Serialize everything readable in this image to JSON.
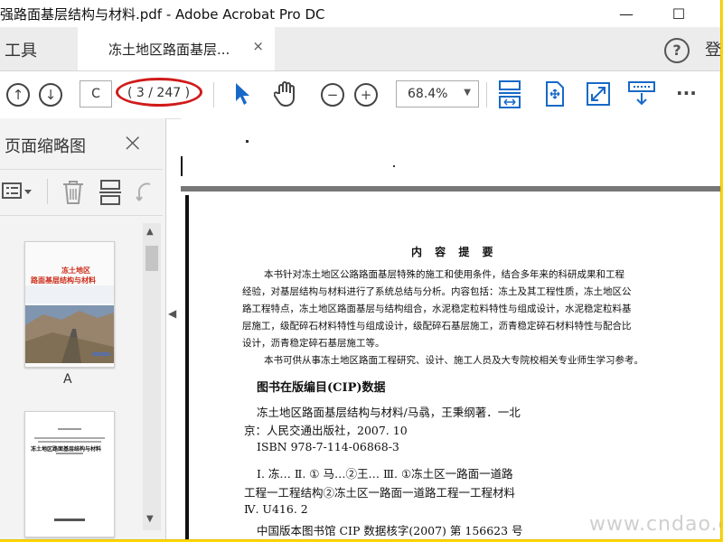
{
  "window": {
    "title": "强路面基层结构与材料.pdf - Adobe Acrobat Pro DC",
    "minimize": "—",
    "maximize": "☐"
  },
  "tabs": {
    "tools": "工具",
    "document": "冻土地区路面基层...",
    "close": "×",
    "help": "?",
    "signin": "登"
  },
  "toolbar": {
    "page_input": "C",
    "page_count": "( 3 / 247 )",
    "zoom": "68.4%",
    "more": "···"
  },
  "panel": {
    "title": "页面缩略图",
    "close": "×",
    "thumb_label_a": "A"
  },
  "thumb1": {
    "title_line1": "冻土地区",
    "title_line2": "路面基层结构与材料"
  },
  "thumb2": {
    "title": "冻土地区路面基层结构与材料"
  },
  "document": {
    "heading": "内 容 提 要",
    "intro_lines": [
      "本书针对冻土地区公路路面基层特殊的施工和使用条件，结合多年来的科研成果和工程",
      "经验，对基层结构与材料进行了系统总结与分析。内容包括：冻土及其工程性质，冻土地区公",
      "路工程特点，冻土地区路面基层与结构组合，水泥稳定粒料特性与组成设计，水泥稳定粒料基",
      "层施工，级配碎石材料特性与组成设计，级配碎石基层施工，沥青稳定碎石材料特性与配合比",
      "设计，沥青稳定碎石基层施工等。",
      "本书可供从事冻土地区路面工程研究、设计、施工人员及大专院校相关专业师生学习参考。"
    ],
    "cip_title": "图书在版编目(CIP)数据",
    "ref_lines": [
      "冻土地区路面基层结构与材料/马骉，王秉纲著．一北",
      "京：人民交通出版社，2007. 10",
      "ISBN  978-7-114-06868-3",
      "Ⅰ. 冻…  Ⅱ. ①  马…②王…  Ⅲ. ①冻土区一路面一道路",
      "工程一工程结构②冻土区一路面一道路工程一工程材料",
      "Ⅳ. U416. 2",
      "中国版本图书馆 CIP 数据核字(2007)   第 156623 号"
    ]
  },
  "watermark": "www.cndao.com",
  "colors": {
    "accent_blue": "#1769c7",
    "annotation_red": "#d01a1a",
    "frame_yellow": "#ffd700"
  },
  "icons": [
    "up-circle-icon",
    "down-circle-icon",
    "select-arrow-icon",
    "hand-icon",
    "zoom-out-icon",
    "zoom-in-icon",
    "fit-width-icon",
    "rotate-icon",
    "fullscreen-icon",
    "read-mode-icon",
    "more-icon",
    "options-icon",
    "trash-icon",
    "extract-icon",
    "undo-icon"
  ]
}
